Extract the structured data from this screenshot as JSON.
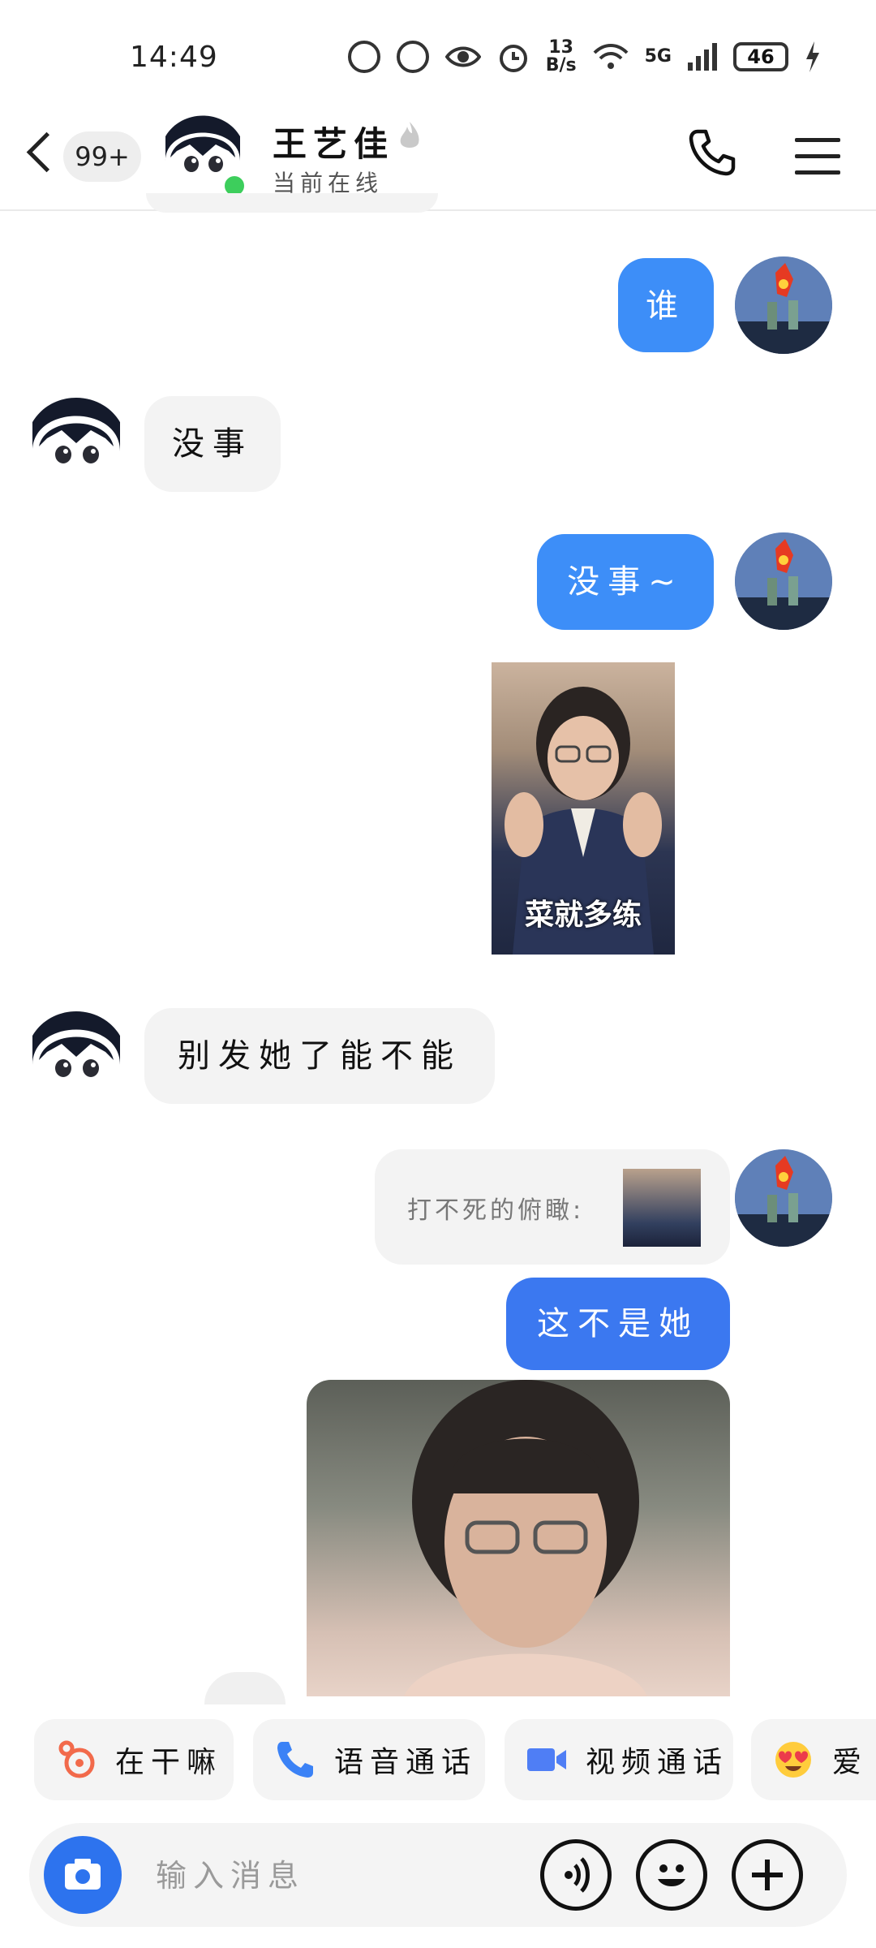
{
  "status_bar": {
    "time": "14:49",
    "net_speed": "13\nB/s",
    "network": "5G",
    "battery": "46"
  },
  "header": {
    "unread_count": "99+",
    "contact_name": "王艺佳",
    "contact_status": "当前在线"
  },
  "messages": [
    {
      "from": "me",
      "text": "谁"
    },
    {
      "from": "her",
      "text": "没事"
    },
    {
      "from": "me",
      "text": "没事~"
    },
    {
      "from": "me",
      "type": "sticker",
      "caption": "菜就多练"
    },
    {
      "from": "her",
      "text": "别发她了能不能"
    },
    {
      "from": "me",
      "type": "quote",
      "text": "打不死的俯瞰:"
    },
    {
      "from": "me",
      "text": "这不是她"
    },
    {
      "from": "me",
      "type": "video"
    }
  ],
  "quick_actions": [
    {
      "label": "在干嘛",
      "icon": "poke-icon"
    },
    {
      "label": "语音通话",
      "icon": "phone-icon"
    },
    {
      "label": "视频通话",
      "icon": "video-camera-icon"
    },
    {
      "label": "爱",
      "icon": "heart-eyes-emoji-icon"
    }
  ],
  "input": {
    "placeholder": "输入消息"
  },
  "colors": {
    "accent_blue": "#3d8ef8",
    "online_green": "#3dce5c",
    "camera_blue": "#2d73ee"
  }
}
